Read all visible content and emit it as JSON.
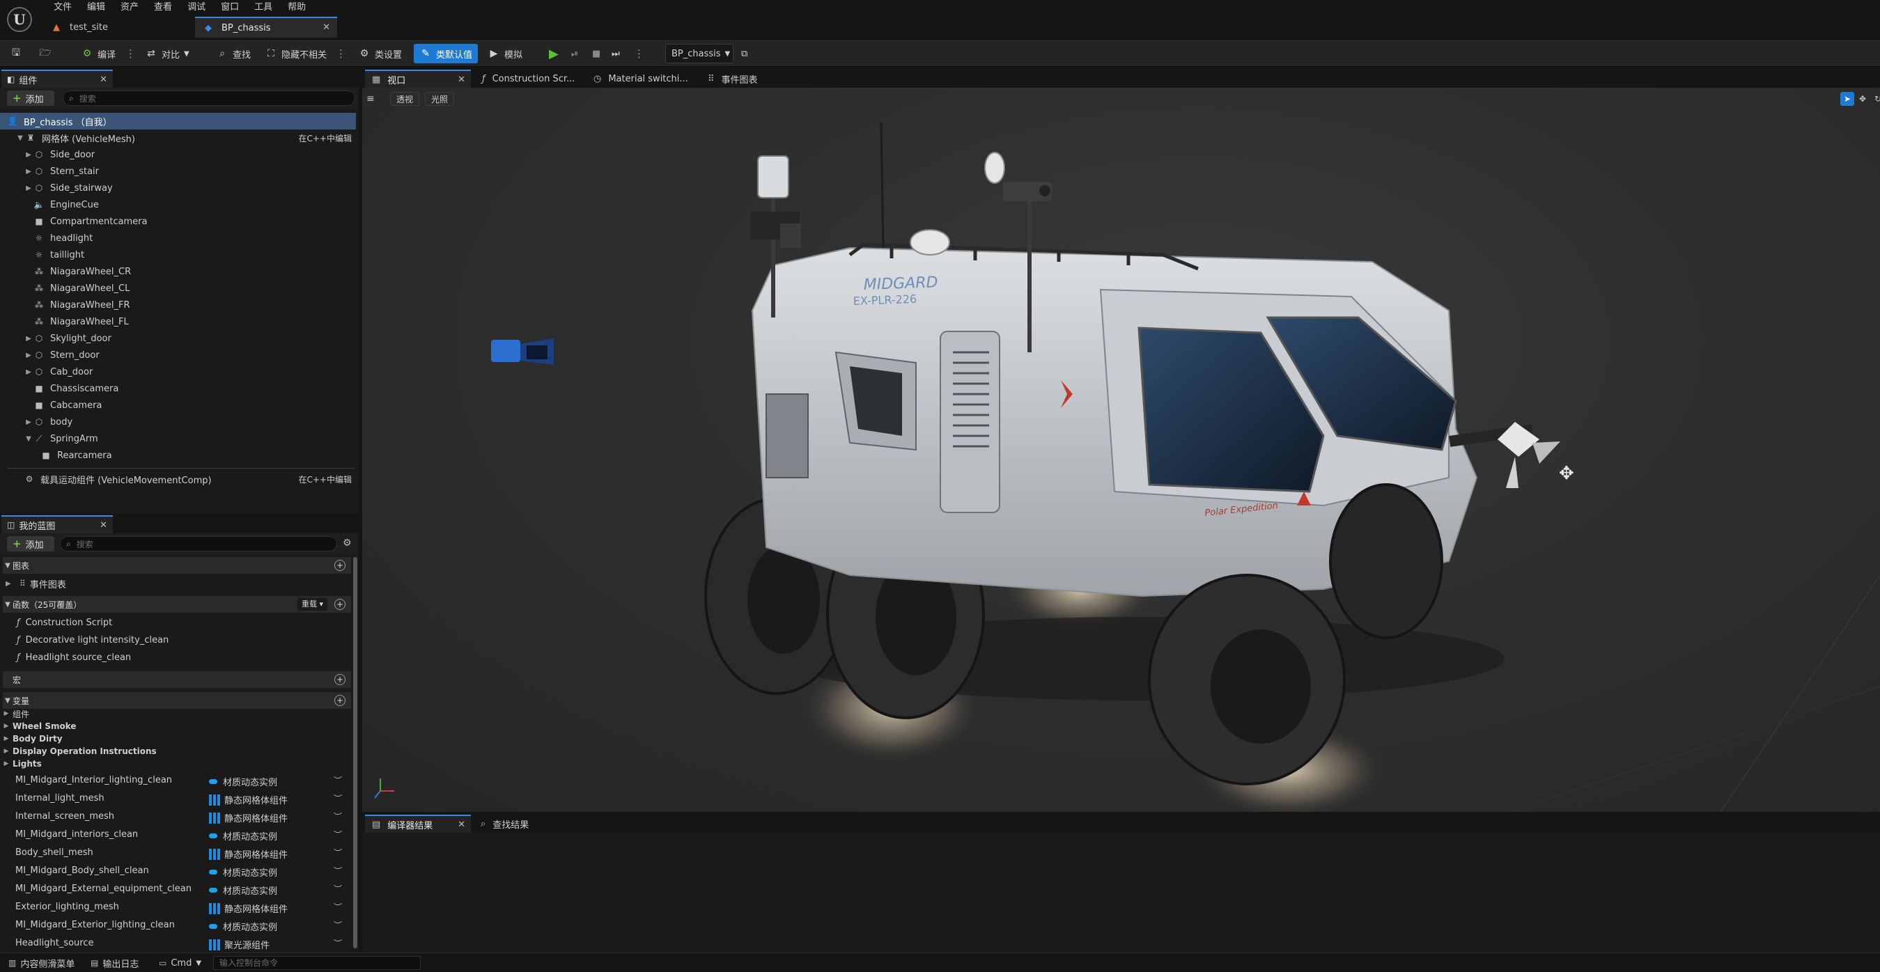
{
  "menu": [
    "文件",
    "编辑",
    "资产",
    "查看",
    "调试",
    "窗口",
    "工具",
    "帮助"
  ],
  "doc_tabs": [
    {
      "label": "test_site",
      "icon": "level-icon"
    },
    {
      "label": "BP_chassis",
      "icon": "blueprint-icon",
      "active": true
    }
  ],
  "toolbar": {
    "compile": "编译",
    "diff": "对比",
    "find": "查找",
    "hide_unrelated": "隐藏不相关",
    "class_settings": "类设置",
    "class_defaults": "类默认值",
    "simulate": "模拟",
    "debug_object": "BP_chassis"
  },
  "components_panel": {
    "title": "组件",
    "add_label": "添加",
    "search_placeholder": "搜索",
    "root": "BP_chassis （自我）",
    "mesh": "网格体 (VehicleMesh)",
    "edit_in_cpp": "在C++中编辑",
    "items": [
      {
        "label": "Side_door",
        "icon": "mesh-icon",
        "expandable": true
      },
      {
        "label": "Stern_stair",
        "icon": "mesh-icon",
        "expandable": true
      },
      {
        "label": "Side_stairway",
        "icon": "mesh-icon",
        "expandable": true
      },
      {
        "label": "EngineCue",
        "icon": "audio-icon",
        "expandable": false
      },
      {
        "label": "Compartmentcamera",
        "icon": "camera-icon",
        "expandable": false
      },
      {
        "label": "headlight",
        "icon": "light-icon",
        "expandable": false
      },
      {
        "label": "taillight",
        "icon": "light-icon",
        "expandable": false
      },
      {
        "label": "NiagaraWheel_CR",
        "icon": "niagara-icon",
        "expandable": false
      },
      {
        "label": "NiagaraWheel_CL",
        "icon": "niagara-icon",
        "expandable": false
      },
      {
        "label": "NiagaraWheel_FR",
        "icon": "niagara-icon",
        "expandable": false
      },
      {
        "label": "NiagaraWheel_FL",
        "icon": "niagara-icon",
        "expandable": false
      },
      {
        "label": "Skylight_door",
        "icon": "mesh-icon",
        "expandable": true
      },
      {
        "label": "Stern_door",
        "icon": "mesh-icon",
        "expandable": true
      },
      {
        "label": "Cab_door",
        "icon": "mesh-icon",
        "expandable": true
      },
      {
        "label": "Chassiscamera",
        "icon": "camera-icon",
        "expandable": false
      },
      {
        "label": "Cabcamera",
        "icon": "camera-icon",
        "expandable": false
      },
      {
        "label": "body",
        "icon": "mesh-icon",
        "expandable": true
      },
      {
        "label": "SpringArm",
        "icon": "springarm-icon",
        "expandable": true,
        "expanded": true
      }
    ],
    "springarm_child": "Rearcamera",
    "movement": "载具运动组件 (VehicleMovementComp)"
  },
  "my_blueprint": {
    "title": "我的蓝图",
    "add_label": "添加",
    "search_placeholder": "搜索",
    "graphs": "图表",
    "event_graph": "事件图表",
    "functions": "函数（25可覆盖）",
    "override": "重载",
    "function_items": [
      "Construction Script",
      "Decorative light intensity_clean",
      "Headlight source_clean"
    ],
    "macros": "宏",
    "variables": "变量",
    "var_categories": [
      "组件",
      "Wheel Smoke",
      "Body Dirty",
      "Display Operation Instructions",
      "Lights"
    ],
    "vars": [
      {
        "name": "MI_Midgard_Interior_lighting_clean",
        "type": "材质动态实例",
        "kind": "pill"
      },
      {
        "name": "Internal_light_mesh",
        "type": "静态网格体组件",
        "kind": "grid"
      },
      {
        "name": "Internal_screen_mesh",
        "type": "静态网格体组件",
        "kind": "grid"
      },
      {
        "name": "MI_Midgard_interiors_clean",
        "type": "材质动态实例",
        "kind": "pill"
      },
      {
        "name": "Body_shell_mesh",
        "type": "静态网格体组件",
        "kind": "grid"
      },
      {
        "name": "MI_Midgard_Body_shell_clean",
        "type": "材质动态实例",
        "kind": "pill"
      },
      {
        "name": "MI_Midgard_External_equipment_clean",
        "type": "材质动态实例",
        "kind": "pill"
      },
      {
        "name": "Exterior_lighting_mesh",
        "type": "静态网格体组件",
        "kind": "grid"
      },
      {
        "name": "MI_Midgard_Exterior_lighting_clean",
        "type": "材质动态实例",
        "kind": "pill"
      },
      {
        "name": "Headlight_source",
        "type": "聚光源组件",
        "kind": "grid"
      }
    ]
  },
  "editor_tabs": [
    {
      "label": "视口",
      "icon": "viewport-icon",
      "active": true
    },
    {
      "label": "Construction Scr...",
      "icon": "function-icon"
    },
    {
      "label": "Material switchi...",
      "icon": "clock-icon"
    },
    {
      "label": "事件图表",
      "icon": "graph-icon"
    }
  ],
  "viewport": {
    "perspective": "透视",
    "lit": "光照",
    "decal_text_1": "MIDGARD",
    "decal_text_2": "EX-PLR-226",
    "decal_text_3": "Polar Expedition"
  },
  "output_tabs": [
    {
      "label": "编译器结果",
      "icon": "compiler-icon",
      "active": true
    },
    {
      "label": "查找结果",
      "icon": "search-icon"
    }
  ],
  "statusbar": {
    "content_drawer": "内容侧滑菜单",
    "output_log": "输出日志",
    "cmd": "Cmd",
    "console_placeholder": "输入控制台命令"
  },
  "colors": {
    "accent": "#1e7ad2",
    "selection": "#3a5578",
    "play": "#57c335"
  }
}
